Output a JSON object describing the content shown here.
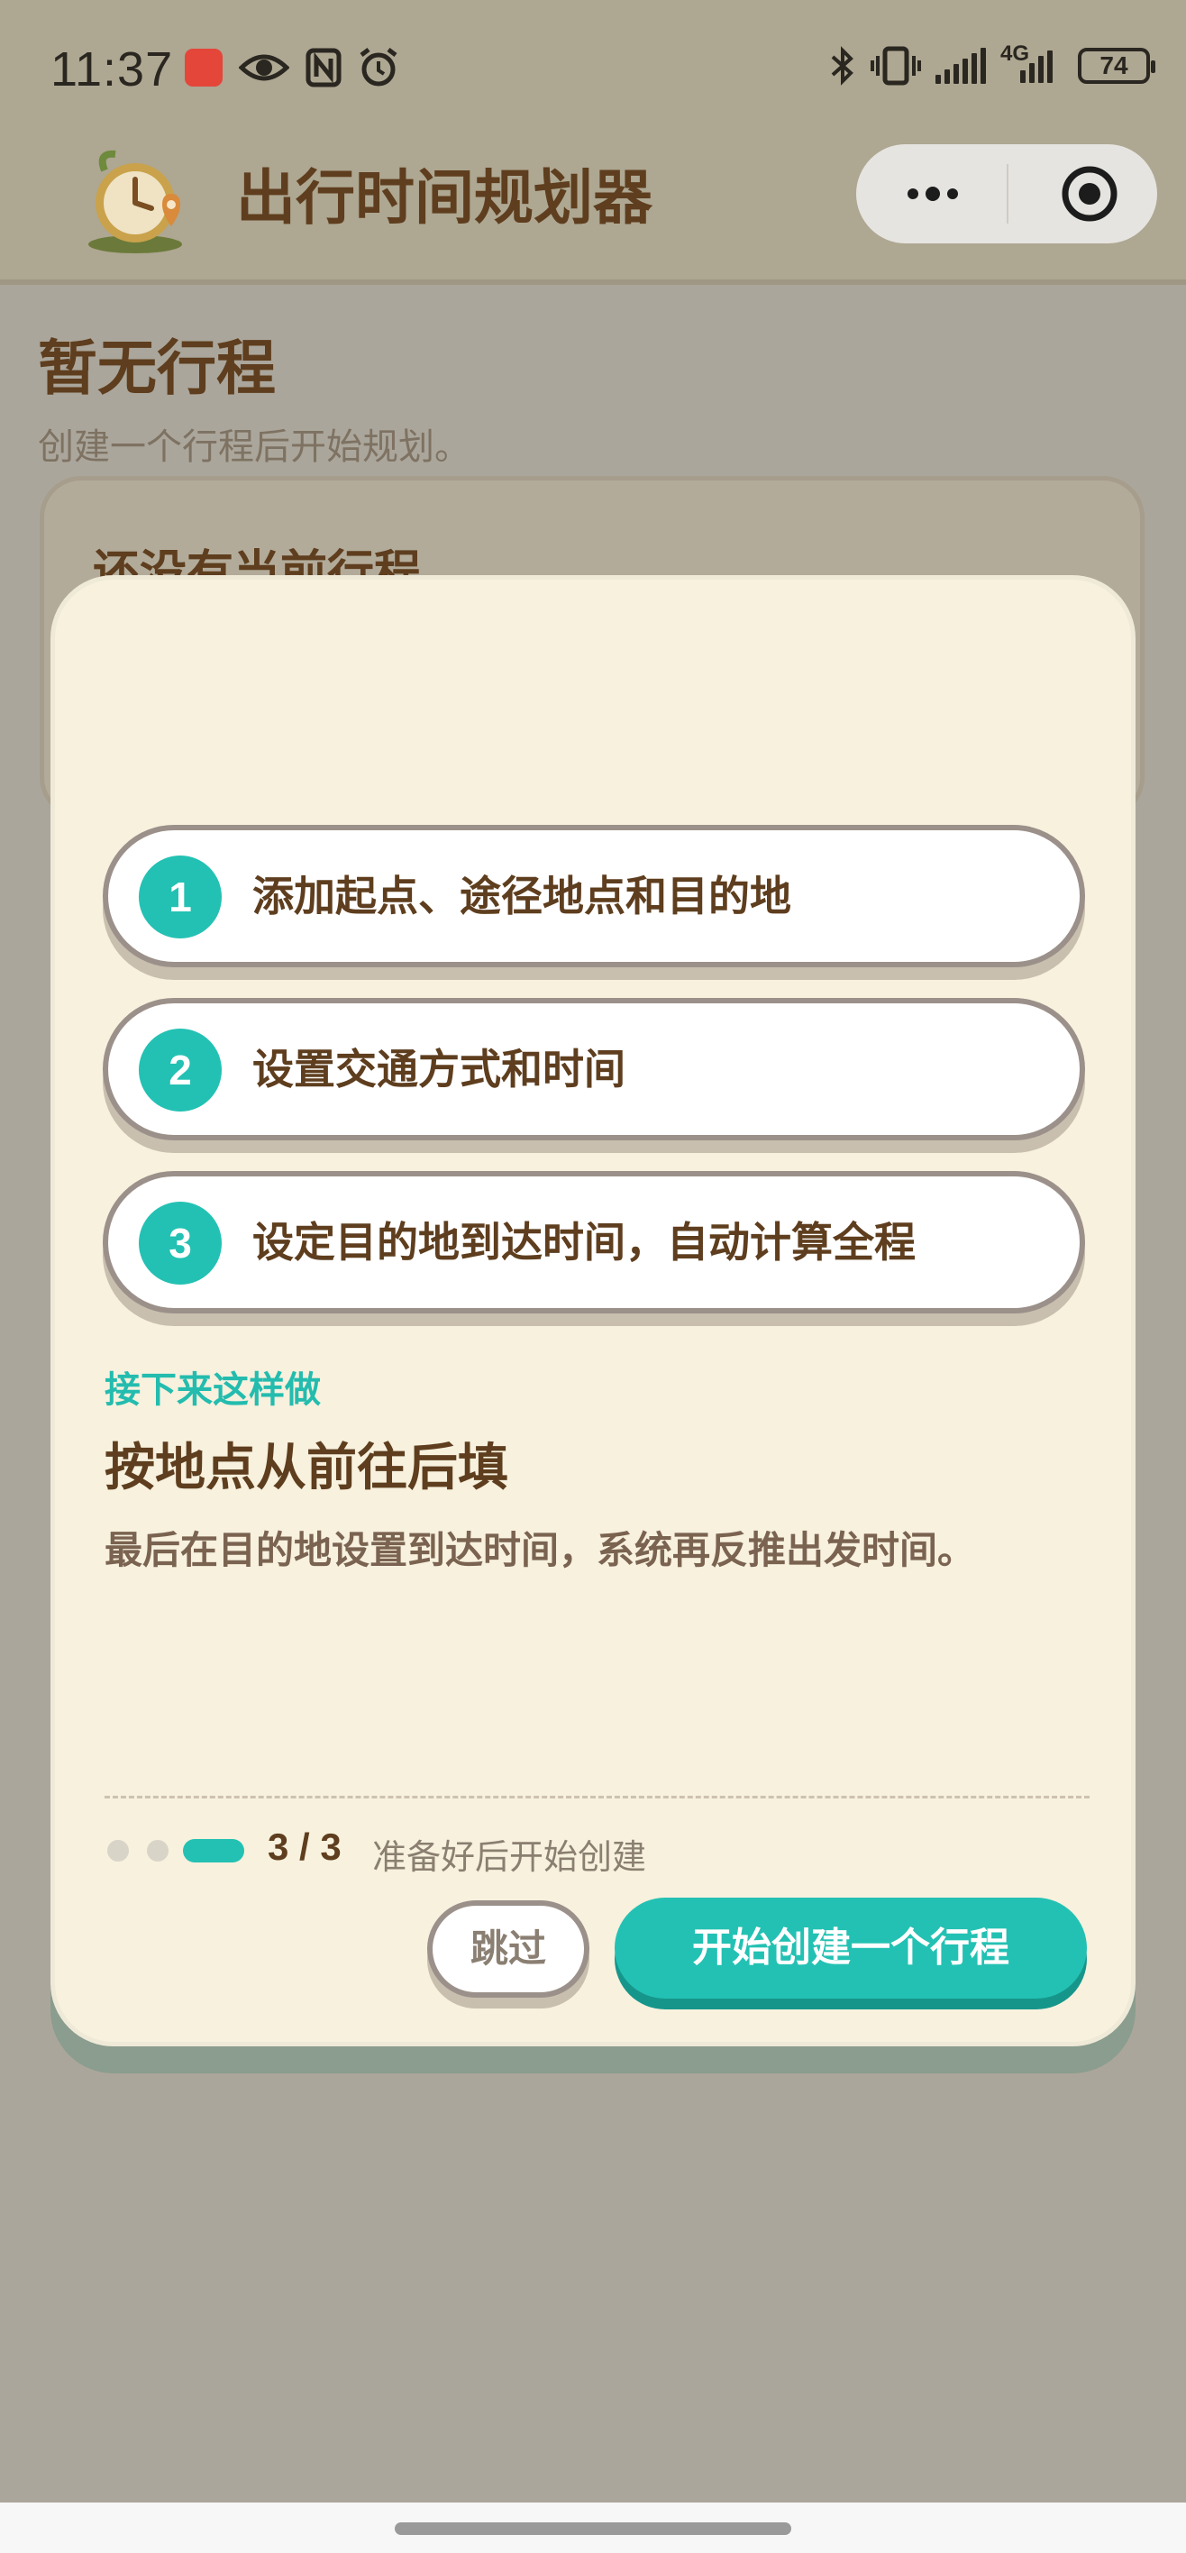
{
  "status_bar": {
    "time": "11:37",
    "app_badge": "HUAWEI",
    "icons_left": [
      "huawei-app-icon",
      "eye-icon",
      "nfc-icon",
      "alarm-icon"
    ],
    "icons_right": [
      "bluetooth-icon",
      "vibrate-icon",
      "signal-icon",
      "signal-4g-icon",
      "battery-icon"
    ],
    "network_label": "4G",
    "battery": "74"
  },
  "nav": {
    "title": "出行时间规划器",
    "logo": "clock-location-logo",
    "capsule": {
      "more": "more-dots-icon",
      "close": "target-icon"
    }
  },
  "background_page": {
    "title": "暂无行程",
    "subtitle": "创建一个行程后开始规划。",
    "card_title": "还没有当前行程"
  },
  "modal": {
    "steps": [
      {
        "num": "1",
        "text": "添加起点、途径地点和目的地"
      },
      {
        "num": "2",
        "text": "设置交通方式和时间"
      },
      {
        "num": "3",
        "text": "设定目的地到达时间，自动计算全程"
      }
    ],
    "next_label": "接下来这样做",
    "next_title": "按地点从前往后填",
    "next_desc": "最后在目的地设置到达时间，系统再反推出发时间。",
    "progress": {
      "current": 3,
      "total": 3,
      "text": "3 / 3",
      "hint": "准备好后开始创建"
    },
    "skip_label": "跳过",
    "start_label": "开始创建一个行程"
  },
  "colors": {
    "accent": "#23c1b3",
    "title_brown": "#5e3e1e",
    "modal_bg": "#f7f1de",
    "overlay": "#aba69b"
  }
}
